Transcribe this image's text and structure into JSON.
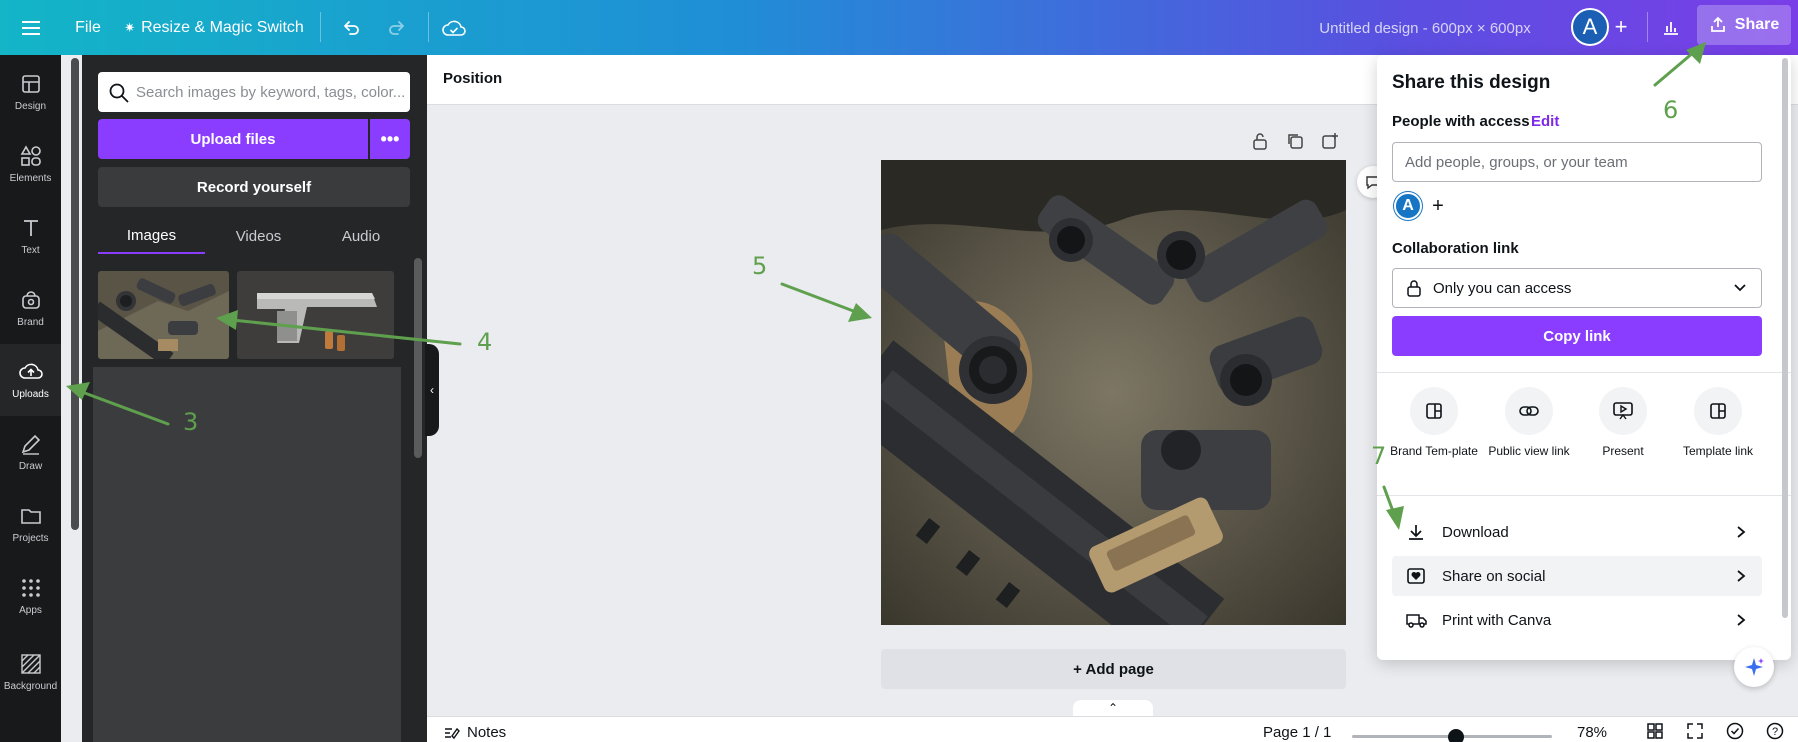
{
  "topbar": {
    "file_label": "File",
    "resize_label": "Resize & Magic Switch",
    "doc_title": "Untitled design - 600px × 600px",
    "avatar_letter": "A",
    "share_label": "Share"
  },
  "rail": {
    "items": [
      {
        "label": "Design"
      },
      {
        "label": "Elements"
      },
      {
        "label": "Text"
      },
      {
        "label": "Brand"
      },
      {
        "label": "Uploads"
      },
      {
        "label": "Draw"
      },
      {
        "label": "Projects"
      },
      {
        "label": "Apps"
      },
      {
        "label": "Background"
      }
    ]
  },
  "uploads": {
    "search_placeholder": "Search images by keyword, tags, color...",
    "upload_label": "Upload files",
    "more_label": "•••",
    "record_label": "Record yourself",
    "tabs": [
      {
        "label": "Images"
      },
      {
        "label": "Videos"
      },
      {
        "label": "Audio"
      }
    ]
  },
  "canvas": {
    "position_label": "Position",
    "add_page_label": "+ Add page"
  },
  "bottombar": {
    "notes_label": "Notes",
    "page_indicator": "Page 1 / 1",
    "zoom": "78%",
    "zoom_fraction": 0.52
  },
  "share": {
    "title": "Share this design",
    "people_label": "People with access",
    "edit_label": "Edit",
    "add_people_placeholder": "Add people, groups, or your team",
    "avatar_letter": "A",
    "collab_label": "Collaboration link",
    "access_value": "Only you can access",
    "copy_link_label": "Copy link",
    "options": [
      {
        "label": "Brand Tem-plate"
      },
      {
        "label": "Public view link"
      },
      {
        "label": "Present"
      },
      {
        "label": "Template link"
      }
    ],
    "list": [
      {
        "label": "Download"
      },
      {
        "label": "Share on social"
      },
      {
        "label": "Print with Canva"
      }
    ]
  },
  "annotations": [
    "3",
    "4",
    "5",
    "6",
    "7"
  ],
  "colors": {
    "accent": "#8b3dff",
    "annotation": "#5fa04e",
    "rail_bg": "#18191b",
    "panel_bg": "#252627"
  }
}
